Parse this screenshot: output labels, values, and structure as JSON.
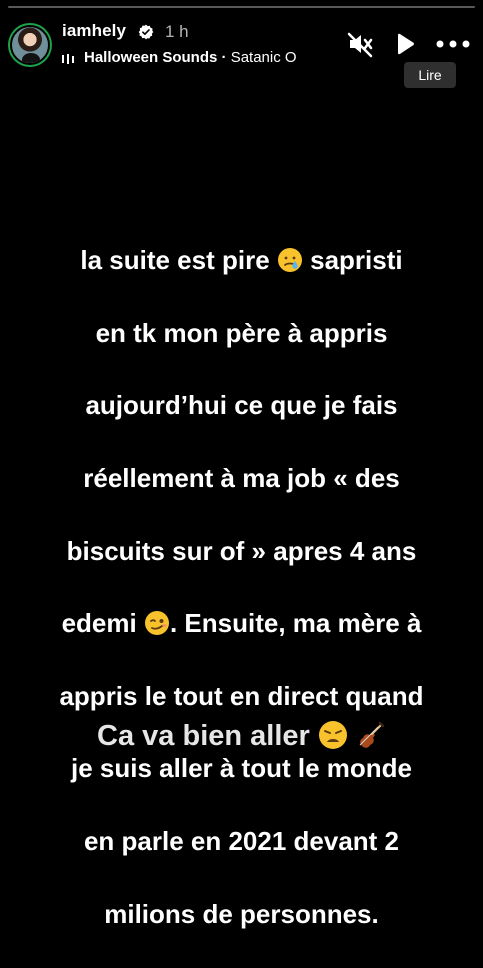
{
  "story": {
    "progress": 0.0,
    "user": {
      "username": "iamhely",
      "verified": true,
      "time_ago": "1 h",
      "avatar": "profile-avatar"
    },
    "music": {
      "title": "Halloween Sounds",
      "separator": " · ",
      "artist": "Satanic O"
    },
    "controls": {
      "mute_icon": "speaker-muted-icon",
      "play_icon": "play-icon",
      "more_icon": "more-horizontal-icon",
      "tooltip": "Lire"
    },
    "text_lines": [
      "la suite est pire",
      " sapristi",
      "en tk mon père à appris",
      "aujourd’hui ce que je fais",
      "réellement à ma job « des",
      "biscuits sur of » apres 4 ans",
      "edemi",
      ".  Ensuite, ma mère à",
      "appris le tout en direct quand",
      "je suis aller à tout le monde",
      "en parle en 2021 devant 2",
      "milions de personnes."
    ],
    "emojis": [
      "crying-face-emoji",
      "woozy-face-emoji",
      "weary-face-emoji",
      "violin-emoji"
    ],
    "bottom_caption": "Ca va bien aller"
  },
  "colors": {
    "background": "#000000",
    "text": "#ffffff",
    "avatar_ring": "#1ea34a",
    "tooltip_bg": "#2f2f2f"
  }
}
